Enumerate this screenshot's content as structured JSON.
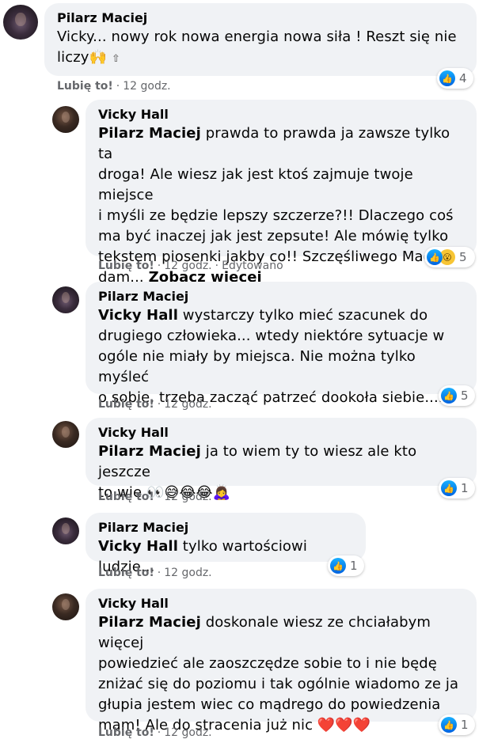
{
  "comments": [
    {
      "author": "Pilarz Maciej",
      "mention": "",
      "lines": [
        "Vicky... nowy rok nowa energia nowa siła ! Reszt się nie",
        "liczy🙌"
      ],
      "trailing_icon": "⇧",
      "like_label": "Lubię to!",
      "time": "12 godz.",
      "edited": "",
      "reaction_count": "4"
    },
    {
      "author": "Vicky Hall",
      "mention": "Pilarz Maciej",
      "lines": [
        " prawda to prawda ja zawsze tylko ta",
        "droga! Ale wiesz jak jest ktoś zajmuje twoje miejsce",
        "i myśli ze będzie lepszy szczerze?!! Dlaczego coś",
        "ma być inaczej jak jest zepsute! Ale mówię tylko",
        "tekstem piosenki jakby co!! Szczęśliwego Maćku",
        "dam... "
      ],
      "see_more": "Zobacz więcej",
      "like_label": "Lubię to!",
      "time": "12 godz.",
      "edited": "Edytowano",
      "reaction_count": "5"
    },
    {
      "author": "Pilarz Maciej",
      "mention": "Vicky Hall",
      "lines": [
        " wystarczy tylko mieć szacunek do",
        "drugiego człowieka... wtedy niektóre sytuacje w",
        "ogóle nie miały by miejsca. Nie można tylko myśleć",
        "o sobie, trzeba zacząć patrzeć dookoła siebie...."
      ],
      "like_label": "Lubię to!",
      "time": "12 godz.",
      "reaction_count": "5"
    },
    {
      "author": "Vicky Hall",
      "mention": "Pilarz Maciej",
      "lines": [
        " ja to wiem ty to wiesz ale kto jeszcze",
        "to wie 👀😅😂😂🙇‍♀️"
      ],
      "like_label": "Lubię to!",
      "time": "12 godz.",
      "reaction_count": "1"
    },
    {
      "author": "Pilarz Maciej",
      "mention": "Vicky Hall",
      "lines": [
        " tylko wartościowi ludzie..."
      ],
      "like_label": "Lubię to!",
      "time": "12 godz.",
      "reaction_count": "1"
    },
    {
      "author": "Vicky Hall",
      "mention": "Pilarz Maciej",
      "lines": [
        " doskonale wiesz ze chciałabym więcej",
        "powiedzieć ale zaoszczędze sobie to i nie będę",
        "zniżać się do poziomu i tak ogólnie wiadomo ze ja",
        "głupia jestem wiec co mądrego do powiedzenia",
        "mam! Ale do stracenia już nic ❤️❤️❤️"
      ],
      "like_label": "Lubię to!",
      "time": "12 godz.",
      "reaction_count": "1"
    }
  ],
  "colors": {
    "bubble": "#f0f2f5",
    "meta": "#65676b",
    "like_blue": "#1877f2"
  },
  "icons": {
    "like": "like-reaction-icon",
    "wow": "wow-reaction-icon",
    "top_fan": "top-fan-badge-icon"
  }
}
